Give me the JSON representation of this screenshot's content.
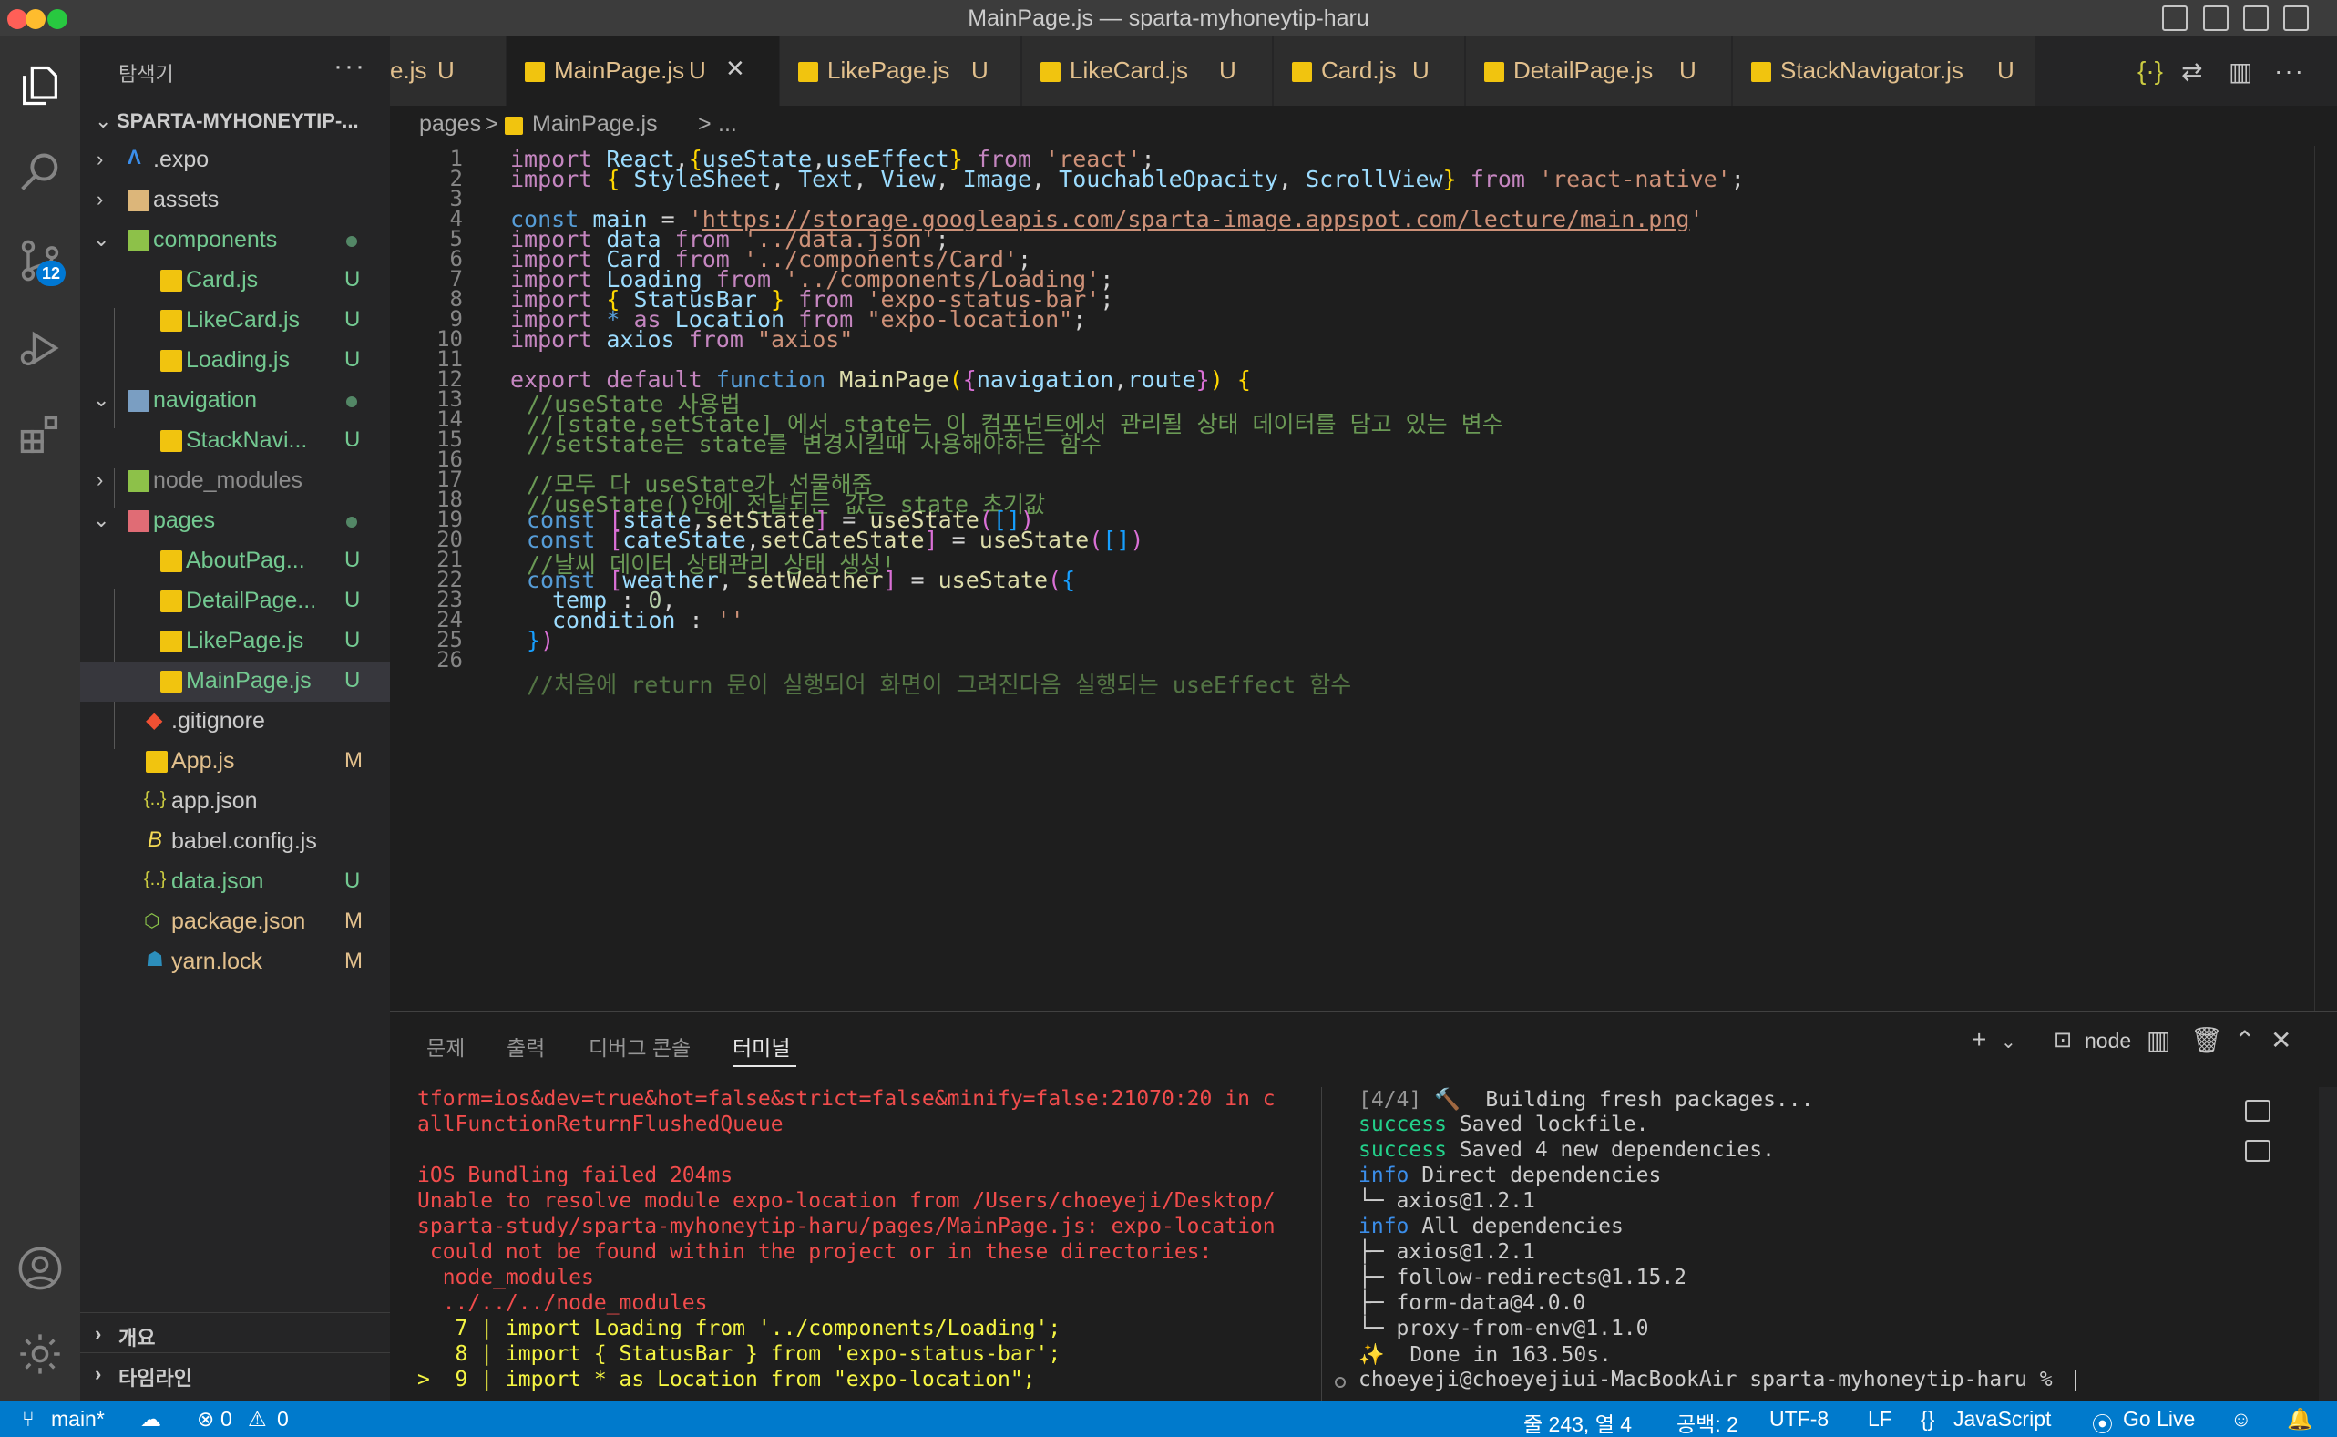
{
  "window": {
    "title": "MainPage.js — sparta-myhoneytip-haru"
  },
  "activity_bar": {
    "source_control_badge": "12"
  },
  "explorer": {
    "title": "탐색기",
    "more": "···",
    "root": "SPARTA-MYHONEYTIP-...",
    "items": [
      {
        "name": ".expo",
        "badge": ""
      },
      {
        "name": "assets",
        "badge": ""
      },
      {
        "name": "components",
        "badge": ""
      },
      {
        "name": "Card.js",
        "badge": "U"
      },
      {
        "name": "LikeCard.js",
        "badge": "U"
      },
      {
        "name": "Loading.js",
        "badge": "U"
      },
      {
        "name": "navigation",
        "badge": ""
      },
      {
        "name": "StackNavi...",
        "badge": "U"
      },
      {
        "name": "node_modules",
        "badge": ""
      },
      {
        "name": "pages",
        "badge": ""
      },
      {
        "name": "AboutPag...",
        "badge": "U"
      },
      {
        "name": "DetailPage...",
        "badge": "U"
      },
      {
        "name": "LikePage.js",
        "badge": "U"
      },
      {
        "name": "MainPage.js",
        "badge": "U"
      },
      {
        "name": ".gitignore",
        "badge": ""
      },
      {
        "name": "App.js",
        "badge": "M"
      },
      {
        "name": "app.json",
        "badge": ""
      },
      {
        "name": "babel.config.js",
        "badge": ""
      },
      {
        "name": "data.json",
        "badge": "U"
      },
      {
        "name": "package.json",
        "badge": "M"
      },
      {
        "name": "yarn.lock",
        "badge": "M"
      }
    ],
    "outline": "개요",
    "timeline": "타임라인"
  },
  "tabs": [
    {
      "label": "e.js",
      "badge": "U"
    },
    {
      "label": "MainPage.js",
      "badge": "U"
    },
    {
      "label": "LikePage.js",
      "badge": "U"
    },
    {
      "label": "LikeCard.js",
      "badge": "U"
    },
    {
      "label": "Card.js",
      "badge": "U"
    },
    {
      "label": "DetailPage.js",
      "badge": "U"
    },
    {
      "label": "StackNavigator.js",
      "badge": "U"
    }
  ],
  "breadcrumb": {
    "folder": "pages",
    "sep": ">",
    "file": "MainPage.js",
    "more": "..."
  },
  "editor": {
    "line_numbers": [
      "1",
      "2",
      "3",
      "4",
      "5",
      "6",
      "7",
      "8",
      "9",
      "10",
      "11",
      "12",
      "13",
      "14",
      "15",
      "16",
      "17",
      "18",
      "19",
      "20",
      "21",
      "22",
      "23",
      "24",
      "25",
      "26"
    ],
    "code": {
      "l4_url": "https://storage.googleapis.com/sparta-image.appspot.com/lecture/main.png",
      "l13": "//useState 사용법",
      "l14": "//[state,setState] 에서 state는 이 컴포넌트에서 관리될 상태 데이터를 담고 있는 변수",
      "l15": "//setState는 state를 변경시킬때 사용해야하는 함수",
      "l17": "//모두 다 useState가 선물해줌",
      "l18": "//useState()안에 전달되는 값은 state 초기값",
      "l21": "//날씨 데이터 상태관리 상태 생성!",
      "l27": "//처음에 return 문이 실행되어 화면이 그려진다음 실행되는 useEffect 함수"
    }
  },
  "panel": {
    "tabs": [
      "문제",
      "출력",
      "디버그 콘솔",
      "터미널"
    ],
    "shell": "node",
    "terminal_left": [
      "tform=ios&dev=true&hot=false&strict=false&minify=false:21070:20 in c",
      "allFunctionReturnFlushedQueue",
      "",
      "iOS Bundling failed 204ms",
      "Unable to resolve module expo-location from /Users/choeyeji/Desktop/",
      "sparta-study/sparta-myhoneytip-haru/pages/MainPage.js: expo-location",
      " could not be found within the project or in these directories:",
      "  node_modules",
      "  ../../../node_modules",
      "   7 | import Loading from '../components/Loading';",
      "   8 | import { StatusBar } from 'expo-status-bar';",
      ">  9 | import * as Location from \"expo-location\";"
    ],
    "terminal_right": {
      "l1_prefix": "[4/4] ",
      "l1_icon": "🔨",
      "l1_text": "  Building fresh packages...",
      "success": "success",
      "l2": " Saved lockfile.",
      "l3": " Saved 4 new dependencies.",
      "info": "info",
      "l4": " Direct dependencies",
      "l5": "└─ axios@1.2.1",
      "l6": " All dependencies",
      "l7": "├─ axios@1.2.1",
      "l8": "├─ follow-redirects@1.15.2",
      "l9": "├─ form-data@4.0.0",
      "l10": "└─ proxy-from-env@1.1.0",
      "l11": "✨  Done in 163.50s.",
      "prompt": "choeyeji@choeyejiui-MacBookAir sparta-myhoneytip-haru % "
    }
  },
  "statusbar": {
    "branch": "main*",
    "errors": "0",
    "warnings": "0",
    "cursor": "줄 243, 열 4",
    "spaces": "공백: 2",
    "encoding": "UTF-8",
    "eol": "LF",
    "language": "JavaScript",
    "live": "Go Live"
  }
}
